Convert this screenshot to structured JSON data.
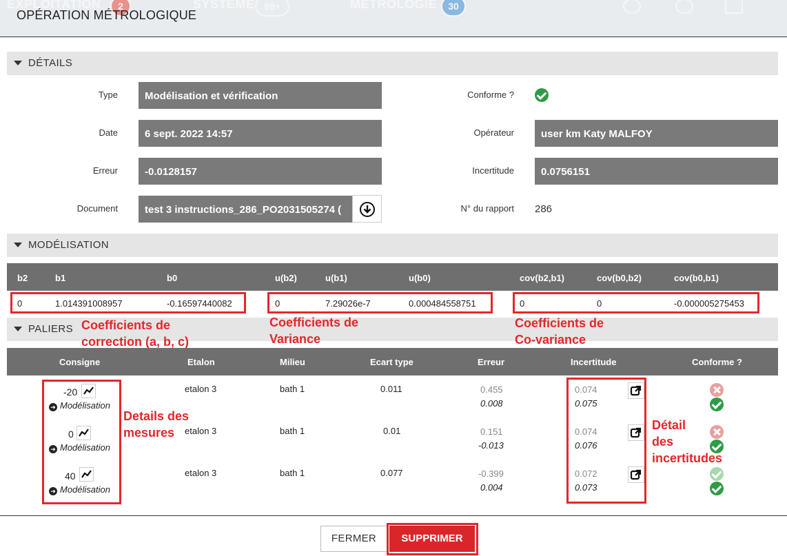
{
  "background": {
    "nav1": "EXPLOITATION",
    "badge1": "2",
    "nav2": "SYSTÈME",
    "badge2": "99+",
    "nav3": "MÉTROLOGIE",
    "badge3": "30"
  },
  "modal": {
    "title": "OPÉRATION MÉTROLOGIQUE"
  },
  "details": {
    "section_title": "DÉTAILS",
    "type_label": "Type",
    "type_value": "Modélisation et vérification",
    "date_label": "Date",
    "date_value": "6 sept. 2022 14:57",
    "erreur_label": "Erreur",
    "erreur_value": "-0.0128157",
    "document_label": "Document",
    "document_value": "test 3 instructions_286_PO2031505274 (",
    "conforme_label": "Conforme ?",
    "operateur_label": "Opérateur",
    "operateur_value": "user km Katy MALFOY",
    "incertitude_label": "Incertitude",
    "incertitude_value": "0.0756151",
    "rapport_label": "N° du rapport",
    "rapport_value": "286"
  },
  "modelisation": {
    "section_title": "MODÉLISATION",
    "headers": [
      "b2",
      "b1",
      "b0",
      "u(b2)",
      "u(b1)",
      "u(b0)",
      "cov(b2,b1)",
      "cov(b0,b2)",
      "cov(b0,b1)"
    ],
    "values": [
      "0",
      "1.014391008957",
      "-0.16597440082",
      "0",
      "7.29026e-7",
      "0.000484558751",
      "0",
      "0",
      "-0.000005275453"
    ]
  },
  "paliers": {
    "section_title": "PALIERS",
    "headers": [
      "Consigne",
      "Etalon",
      "Milieu",
      "Ecart type",
      "Erreur",
      "Incertitude",
      "Conforme ?"
    ],
    "link_label": "Modélisation",
    "rows": [
      {
        "consigne": "-20",
        "etalon": "etalon 3",
        "milieu": "bath 1",
        "ecart": "0.011",
        "erreur1": "0.455",
        "erreur2": "0.008",
        "inc1": "0.074",
        "inc2": "0.075"
      },
      {
        "consigne": "0",
        "etalon": "etalon 3",
        "milieu": "bath 1",
        "ecart": "0.01",
        "erreur1": "0.151",
        "erreur2": "-0.013",
        "inc1": "0.074",
        "inc2": "0.076"
      },
      {
        "consigne": "40",
        "etalon": "etalon 3",
        "milieu": "bath 1",
        "ecart": "0.077",
        "erreur1": "-0.399",
        "erreur2": "0.004",
        "inc1": "0.072",
        "inc2": "0.073"
      }
    ]
  },
  "annotations": {
    "coef_correction": "Coefficients de\ncorrection (a, b, c)",
    "coef_variance": "Coefficients de\nVariance",
    "coef_covariance": "Coefficients de\nCo-variance",
    "details_mesures": "Details des\nmesures",
    "detail_incertitudes": "Détail\ndes\nincertitudes"
  },
  "footer": {
    "close_label": "FERMER",
    "delete_label": "SUPPRIMER"
  },
  "colors": {
    "accent": "#d9262b",
    "annotation": "#e4262b",
    "ok": "#2e9c47",
    "ko": "#e8a0a0",
    "field_bg": "#7a7a7a",
    "header_bg": "#6f6f6f"
  }
}
